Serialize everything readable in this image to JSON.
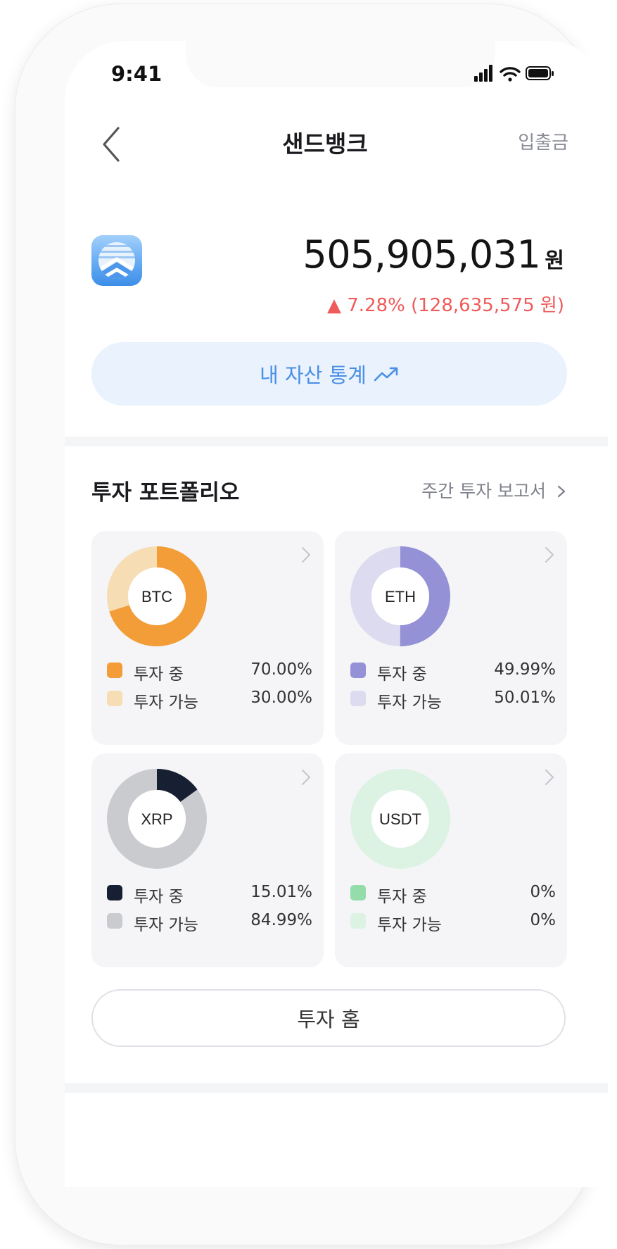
{
  "status_bar": {
    "time": "9:41"
  },
  "header": {
    "title": "샌드뱅크",
    "right_link": "입출금",
    "back_icon": "chevron-left-icon"
  },
  "balance": {
    "amount": "505,905,031",
    "unit": "원",
    "change": "▲ 7.28% (128,635,575 원)",
    "change_color": "#ef5a5a"
  },
  "stats_button": {
    "label": "내 자산 통계",
    "icon": "trend-up-icon"
  },
  "portfolio": {
    "title": "투자 포트폴리오",
    "report_link": "주간 투자 보고서",
    "cards": [
      {
        "coin": "BTC",
        "invested_pct": 70.0,
        "available_pct": 30.0,
        "invested_label": "투자 중",
        "available_label": "투자 가능",
        "invested_text": "70.00%",
        "available_text": "30.00%",
        "invested_color": "#f29d38",
        "available_color": "#f6ddb3"
      },
      {
        "coin": "ETH",
        "invested_pct": 49.99,
        "available_pct": 50.01,
        "invested_label": "투자 중",
        "available_label": "투자 가능",
        "invested_text": "49.99%",
        "available_text": "50.01%",
        "invested_color": "#9491d6",
        "available_color": "#dddbef"
      },
      {
        "coin": "XRP",
        "invested_pct": 15.01,
        "available_pct": 84.99,
        "invested_label": "투자 중",
        "available_label": "투자 가능",
        "invested_text": "15.01%",
        "available_text": "84.99%",
        "invested_color": "#172033",
        "available_color": "#c9cbcf"
      },
      {
        "coin": "USDT",
        "invested_pct": 0,
        "available_pct": 0,
        "invested_label": "투자 중",
        "available_label": "투자 가능",
        "invested_text": "0%",
        "available_text": "0%",
        "invested_color": "#94dcaa",
        "available_color": "#dcf2e3"
      }
    ]
  },
  "home_button": {
    "label": "투자 홈"
  }
}
